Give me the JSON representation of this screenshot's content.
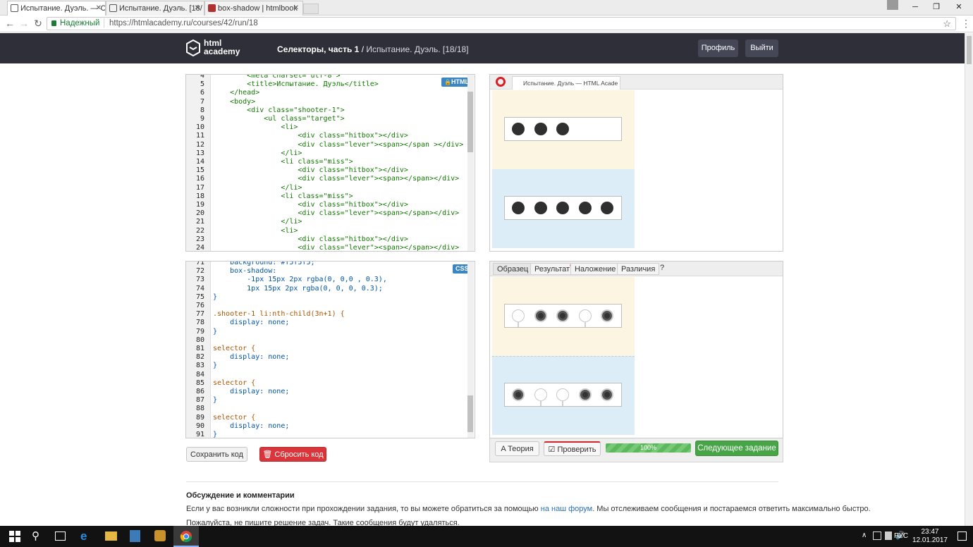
{
  "browser": {
    "tabs": [
      {
        "title": "Испытание. Дуэль. — С",
        "active": true
      },
      {
        "title": "Испытание. Дуэль. [18/",
        "active": false
      },
      {
        "title": "box-shadow | htmlbook",
        "active": false
      }
    ],
    "secure_label": "Надежный",
    "url": "https://htmlacademy.ru/courses/42/run/18"
  },
  "header": {
    "logo_line1": "html",
    "logo_line2": "academy",
    "crumb_section": "Селекторы, часть 1",
    "crumb_sep": " / ",
    "crumb_page": "Испытание. Дуэль. [18/18]",
    "profile_button": "Профиль",
    "logout_button": "Выйти"
  },
  "html_editor": {
    "badge": "HTML",
    "lines": [
      {
        "n": "4",
        "t": "        <meta charset=\"utf-8\">"
      },
      {
        "n": "5",
        "t": "        <title>Испытание. Дуэль</title>"
      },
      {
        "n": "6",
        "t": "    </head>"
      },
      {
        "n": "7",
        "t": "    <body>"
      },
      {
        "n": "8",
        "t": "        <div class=\"shooter-1\">"
      },
      {
        "n": "9",
        "t": "            <ul class=\"target\">"
      },
      {
        "n": "10",
        "t": "                <li>"
      },
      {
        "n": "11",
        "t": "                    <div class=\"hitbox\"></div>"
      },
      {
        "n": "12",
        "t": "                    <div class=\"lever\"><span></span ></div>"
      },
      {
        "n": "13",
        "t": "                </li>"
      },
      {
        "n": "14",
        "t": "                <li class=\"miss\">"
      },
      {
        "n": "15",
        "t": "                    <div class=\"hitbox\"></div>"
      },
      {
        "n": "16",
        "t": "                    <div class=\"lever\"><span></span></div>"
      },
      {
        "n": "17",
        "t": "                </li>"
      },
      {
        "n": "18",
        "t": "                <li class=\"miss\">"
      },
      {
        "n": "19",
        "t": "                    <div class=\"hitbox\"></div>"
      },
      {
        "n": "20",
        "t": "                    <div class=\"lever\"><span></span></div>"
      },
      {
        "n": "21",
        "t": "                </li>"
      },
      {
        "n": "22",
        "t": "                <li>"
      },
      {
        "n": "23",
        "t": "                    <div class=\"hitbox\"></div>"
      },
      {
        "n": "24",
        "t": "                    <div class=\"lever\"><span></span></div>"
      }
    ]
  },
  "css_editor": {
    "badge": "CSS",
    "lines": [
      {
        "n": "71",
        "t": "    background: #f5f5f5;"
      },
      {
        "n": "72",
        "t": "    box-shadow:"
      },
      {
        "n": "73",
        "t": "        -1px 15px 2px rgba(0, 0,0 , 0.3),"
      },
      {
        "n": "74",
        "t": "        1px 15px 2px rgba(0, 0, 0, 0.3);"
      },
      {
        "n": "75",
        "t": "}"
      },
      {
        "n": "76",
        "t": ""
      },
      {
        "n": "77",
        "t": ".shooter-1 li:nth-child(3n+1) {"
      },
      {
        "n": "78",
        "t": "    display: none;"
      },
      {
        "n": "79",
        "t": "}"
      },
      {
        "n": "80",
        "t": ""
      },
      {
        "n": "81",
        "t": "selector {"
      },
      {
        "n": "82",
        "t": "    display: none;"
      },
      {
        "n": "83",
        "t": "}"
      },
      {
        "n": "84",
        "t": ""
      },
      {
        "n": "85",
        "t": "selector {"
      },
      {
        "n": "86",
        "t": "    display: none;"
      },
      {
        "n": "87",
        "t": "}"
      },
      {
        "n": "88",
        "t": ""
      },
      {
        "n": "89",
        "t": "selector {"
      },
      {
        "n": "90",
        "t": "    display: none;"
      },
      {
        "n": "91",
        "t": "}"
      }
    ]
  },
  "preview_top": {
    "tab_title": "Испытание. Дуэль — HTML Acade"
  },
  "result_tabs": {
    "sample": "Образец",
    "result": "Результат",
    "result_marker": "*",
    "overlay": "Наложение",
    "diff": "Различия",
    "help": "?"
  },
  "buttons": {
    "save": "Сохранить код",
    "reset": "Сбросить код",
    "theory": "Теория",
    "check": "Проверить",
    "progress": "100%",
    "next": "Следующее задание"
  },
  "progress_fraction": 1.0,
  "discussion": {
    "title": "Обсуждение и комментарии",
    "p1_before": "Если у вас возникли сложности при прохождении задания, то вы можете обратиться за помощью ",
    "p1_link": "на наш форум",
    "p1_after": ". Мы отслеживаем сообщения и постараемся ответить максимально быстро.",
    "p2": "Пожалуйста, не пишите решение задач. Такие сообщения будут удаляться."
  },
  "taskbar": {
    "lang": "РУС",
    "time": "23:47",
    "date": "12.01.2017"
  }
}
